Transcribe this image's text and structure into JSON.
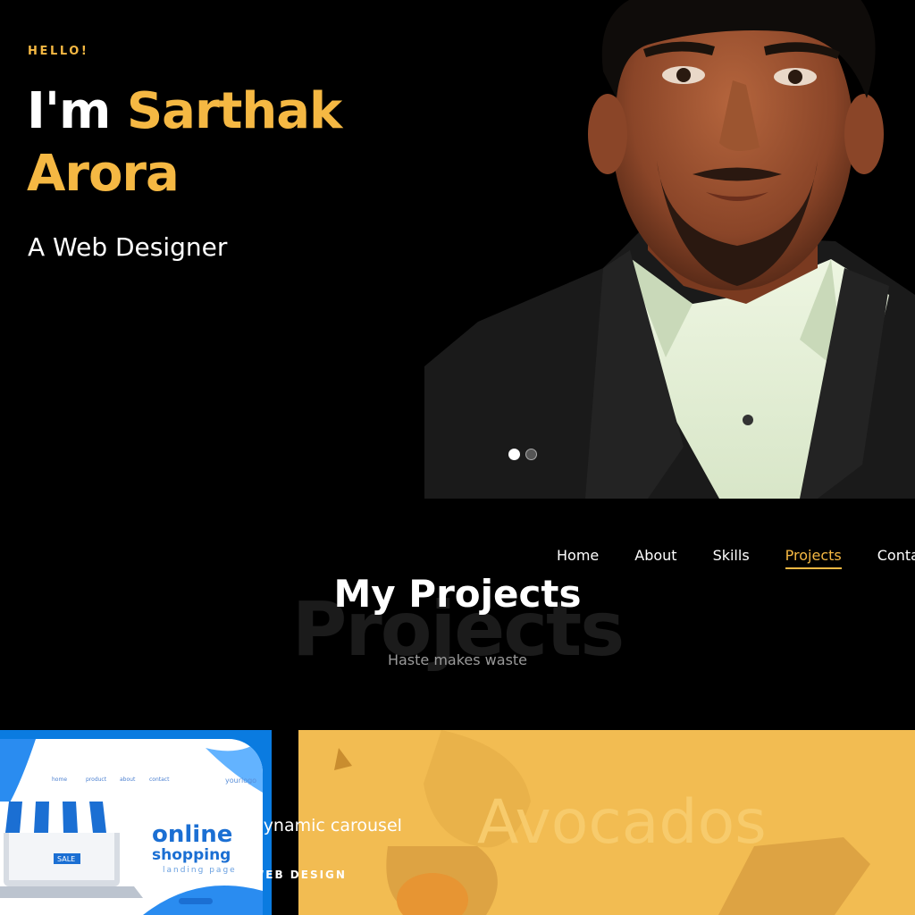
{
  "hero": {
    "greeting": "HELLO!",
    "name_prefix": "I'm",
    "first_name": "Sarthak",
    "last_name": "Arora",
    "role": "A Web Designer"
  },
  "nav": {
    "items": [
      "Home",
      "About",
      "Skills",
      "Projects",
      "Contact"
    ],
    "active": "Projects"
  },
  "projects_section": {
    "title": "My Projects",
    "background_word": "Projects",
    "subtitle": "Haste makes waste"
  },
  "projects": [
    {
      "thumbnail_nav": [
        "home",
        "product",
        "about",
        "contact"
      ],
      "thumbnail_logo": "yourlogo",
      "thumbnail_heading_1": "online",
      "thumbnail_heading_2": "shopping",
      "thumbnail_caption": "landing page",
      "thumbnail_badge": "SALE"
    },
    {
      "title": "Dynamic carousel",
      "category": "WEB DESIGN",
      "background_word": "Avocados"
    }
  ],
  "colors": {
    "accent": "#f5b843",
    "background": "#000000",
    "project_blue": "#0a7be0",
    "project_yellow": "#f2bc52"
  }
}
